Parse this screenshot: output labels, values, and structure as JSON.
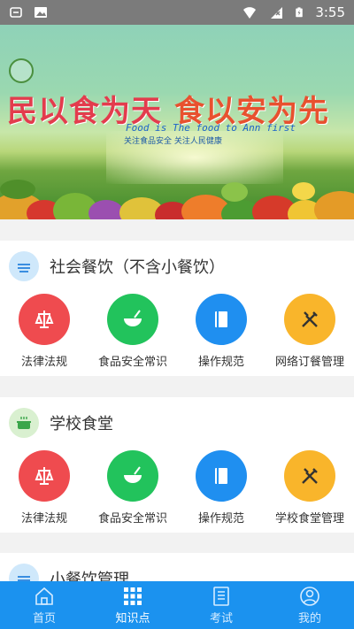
{
  "status_bar": {
    "time": "3:55"
  },
  "banner": {
    "slogan_part1": "民以食为天",
    "slogan_part2": "食以安为先",
    "english": "Food is The food to Ann first",
    "sub": "关注食品安全  关注人民健康"
  },
  "sections": [
    {
      "title": "社会餐饮（不含小餐饮）",
      "items": [
        {
          "label": "法律法规",
          "icon": "scales-icon",
          "color": "#ef4b4f"
        },
        {
          "label": "食品安全常识",
          "icon": "bowl-icon",
          "color": "#22c35c"
        },
        {
          "label": "操作规范",
          "icon": "book-icon",
          "color": "#1f8ff0"
        },
        {
          "label": "网络订餐管理",
          "icon": "tools-icon",
          "color": "#f9b52b"
        }
      ]
    },
    {
      "title": "学校食堂",
      "items": [
        {
          "label": "法律法规",
          "icon": "scales-icon",
          "color": "#ef4b4f"
        },
        {
          "label": "食品安全常识",
          "icon": "bowl-icon",
          "color": "#22c35c"
        },
        {
          "label": "操作规范",
          "icon": "book-icon",
          "color": "#1f8ff0"
        },
        {
          "label": "学校食堂管理",
          "icon": "tools-icon",
          "color": "#f9b52b"
        }
      ]
    },
    {
      "title": "小餐饮管理"
    }
  ],
  "nav": [
    {
      "label": "首页",
      "icon": "home-icon",
      "active": false
    },
    {
      "label": "知识点",
      "icon": "grid-icon",
      "active": true
    },
    {
      "label": "考试",
      "icon": "document-icon",
      "active": false
    },
    {
      "label": "我的",
      "icon": "user-icon",
      "active": false
    }
  ]
}
